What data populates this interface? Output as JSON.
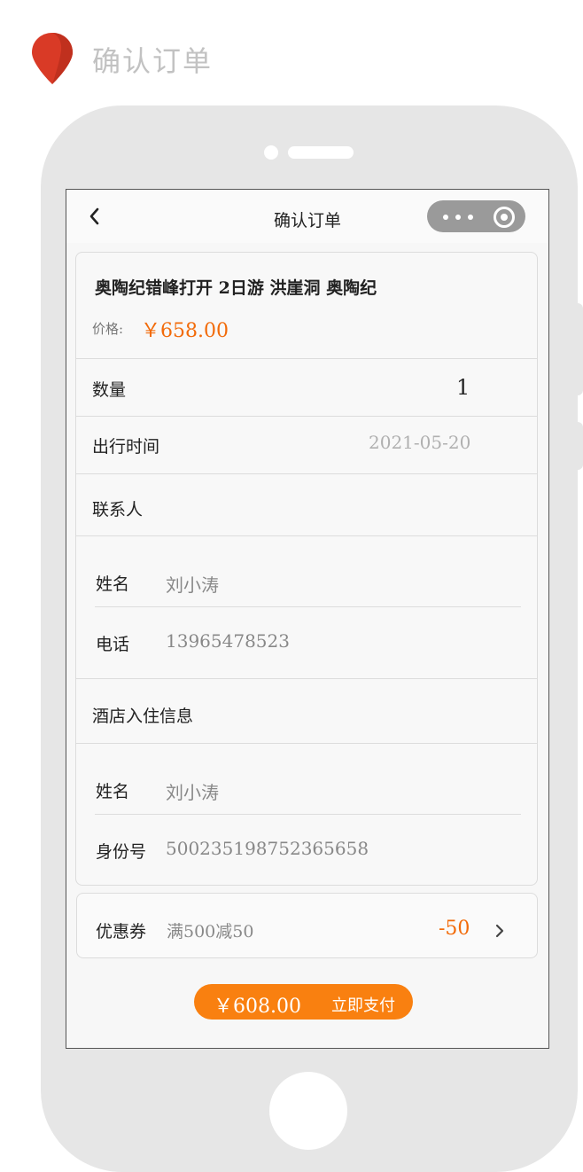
{
  "page": {
    "heading": "确认订单"
  },
  "navbar": {
    "title": "确认订单"
  },
  "order": {
    "product_title": "奥陶纪错峰打开 2日游 洪崖洞 奥陶纪",
    "price_label": "价格:",
    "price_value": "￥658.00",
    "quantity_label": "数量",
    "quantity_value": "1",
    "date_label": "出行时间",
    "date_value": "2021-05-20"
  },
  "contact": {
    "section_label": "联系人",
    "name_label": "姓名",
    "name_value": "刘小涛",
    "phone_label": "电话",
    "phone_value": "13965478523"
  },
  "hotel": {
    "section_label": "酒店入住信息",
    "name_label": "姓名",
    "name_value": "刘小涛",
    "id_label": "身份号",
    "id_value": "500235198752365658"
  },
  "coupon": {
    "label": "优惠券",
    "description": "满500减50",
    "amount": "-50"
  },
  "pay": {
    "total": "￥608.00",
    "button_label": "立即支付"
  },
  "colors": {
    "accent": "#f98010",
    "price": "#f26b0a",
    "pin": "#d93a26",
    "phone_frame": "#e6e6e6"
  },
  "icons": [
    "location-pin-icon",
    "back-arrow-icon",
    "more-dots-icon",
    "close-target-icon",
    "chevron-right-icon"
  ]
}
